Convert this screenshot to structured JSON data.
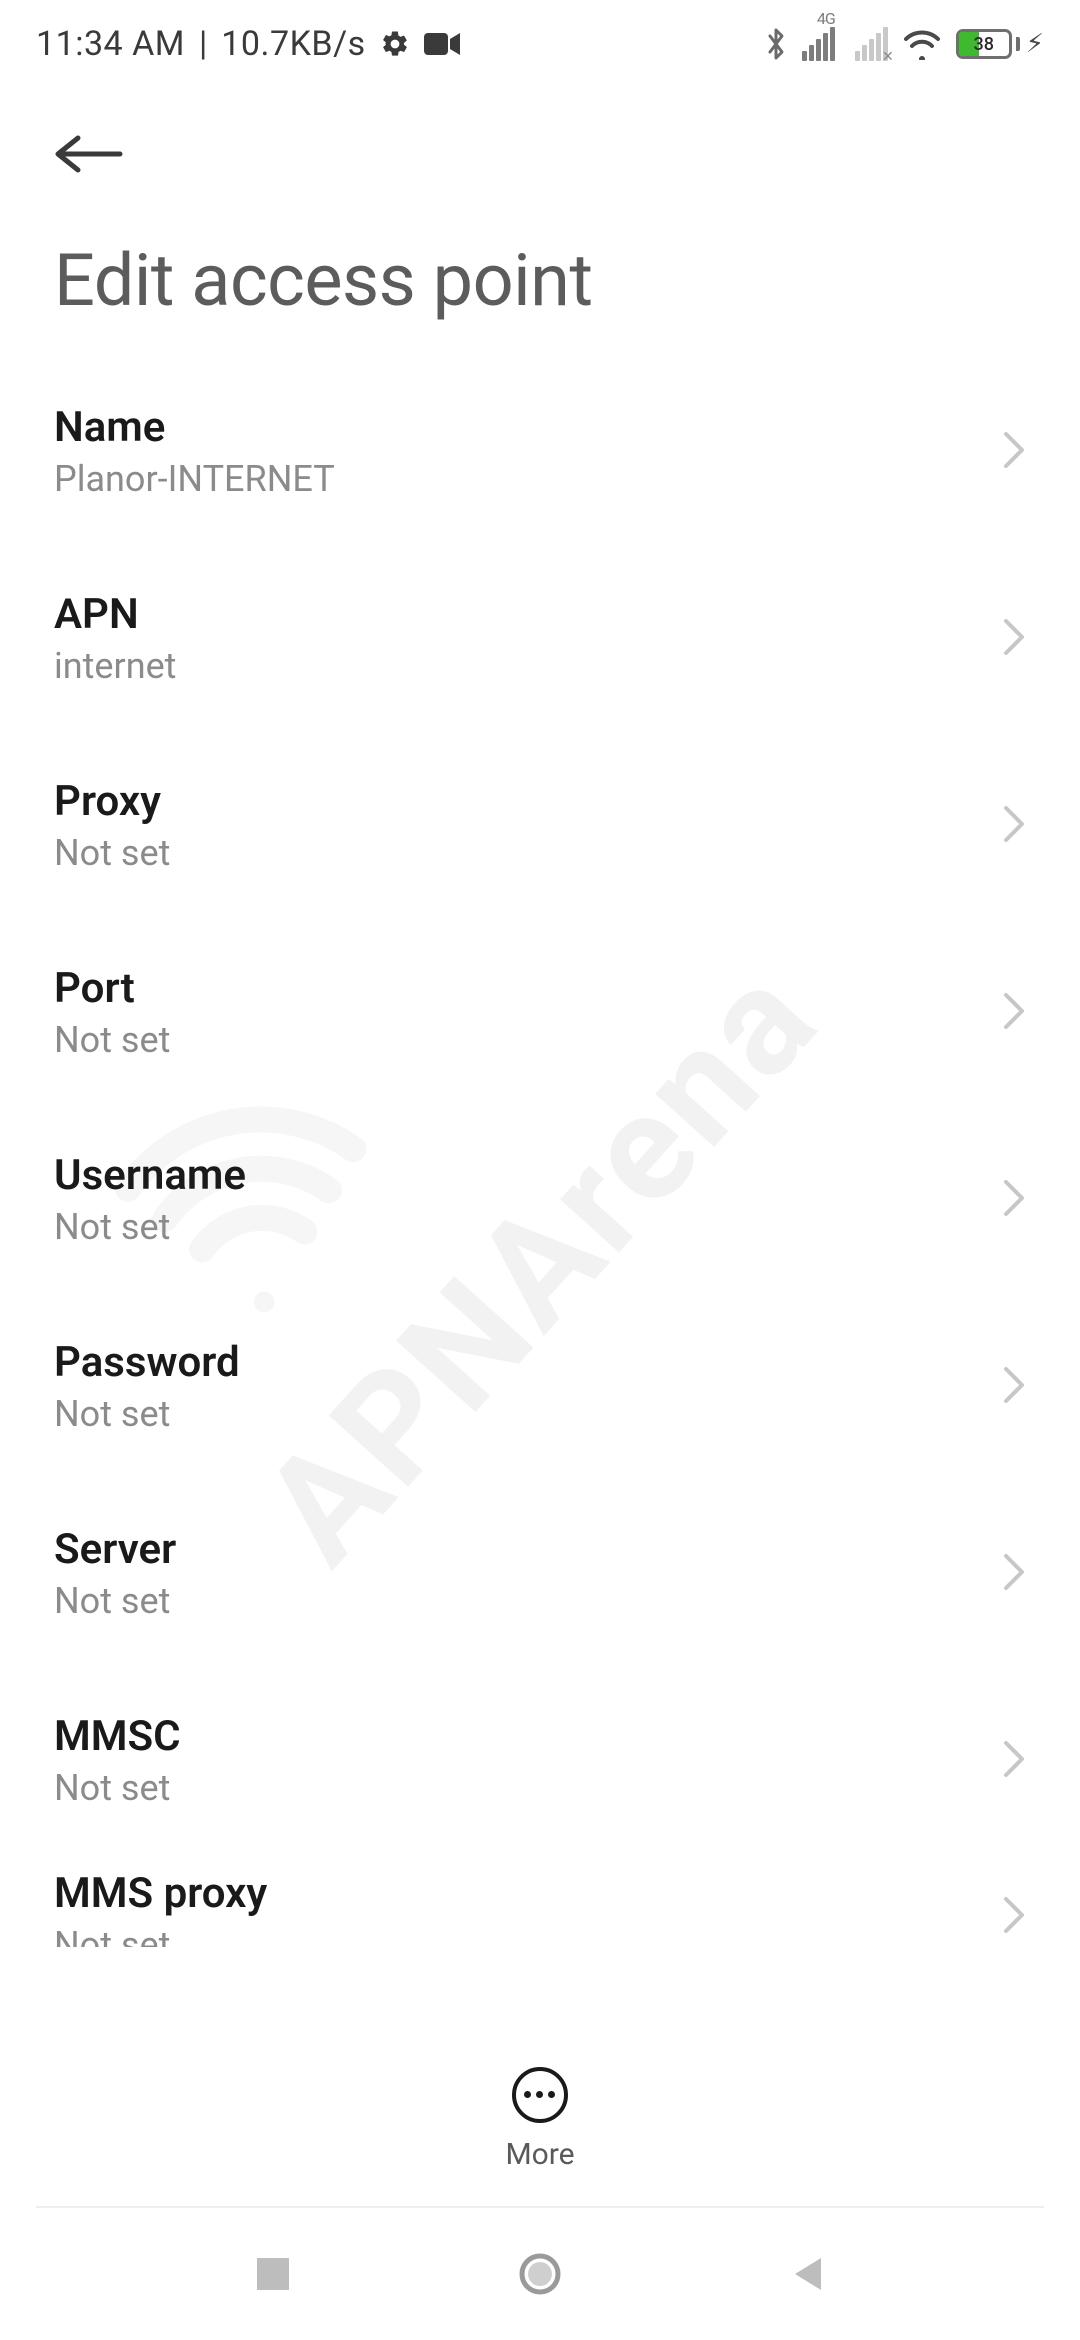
{
  "status": {
    "time": "11:34 AM",
    "sep": "|",
    "net_speed": "10.7KB/s",
    "sig_4g": "4G",
    "battery_pct": "38"
  },
  "header": {
    "title": "Edit access point"
  },
  "settings": {
    "name": {
      "label": "Name",
      "value": "Planor-INTERNET"
    },
    "apn": {
      "label": "APN",
      "value": "internet"
    },
    "proxy": {
      "label": "Proxy",
      "value": "Not set"
    },
    "port": {
      "label": "Port",
      "value": "Not set"
    },
    "username": {
      "label": "Username",
      "value": "Not set"
    },
    "password": {
      "label": "Password",
      "value": "Not set"
    },
    "server": {
      "label": "Server",
      "value": "Not set"
    },
    "mmsc": {
      "label": "MMSC",
      "value": "Not set"
    },
    "mmsproxy": {
      "label": "MMS proxy",
      "value": "Not set"
    }
  },
  "bottom": {
    "more": "More"
  },
  "watermark": "APNArena"
}
